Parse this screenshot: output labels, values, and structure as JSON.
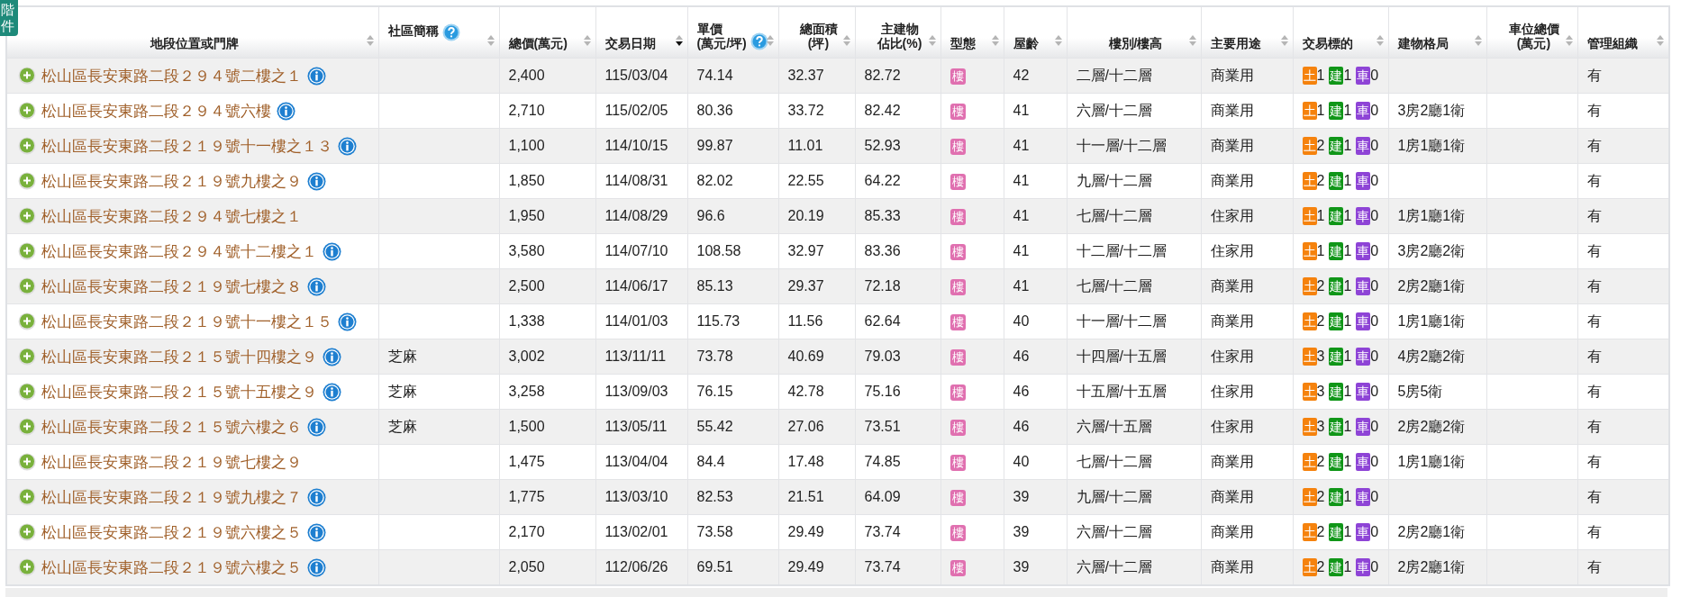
{
  "filter_tab": {
    "lines": [
      "階",
      "件"
    ]
  },
  "table": {
    "columns": [
      {
        "lines": [
          "地段位置或門牌"
        ],
        "help": false,
        "sorted": false
      },
      {
        "lines": [
          "社區簡稱"
        ],
        "help": true,
        "sorted": false
      },
      {
        "lines": [
          "總價(萬元)"
        ],
        "help": false,
        "sorted": false
      },
      {
        "lines": [
          "交易日期"
        ],
        "help": false,
        "sorted": true
      },
      {
        "lines": [
          "單價",
          "(萬元/坪)"
        ],
        "help": true,
        "sorted": false
      },
      {
        "lines": [
          "總面積",
          "(坪)"
        ],
        "help": false,
        "sorted": false
      },
      {
        "lines": [
          "主建物",
          "佔比(%)"
        ],
        "help": false,
        "sorted": false
      },
      {
        "lines": [
          "型態"
        ],
        "help": false,
        "sorted": false
      },
      {
        "lines": [
          "屋齡"
        ],
        "help": false,
        "sorted": false
      },
      {
        "lines": [
          "樓別/樓高"
        ],
        "help": false,
        "sorted": false
      },
      {
        "lines": [
          "主要用途"
        ],
        "help": false,
        "sorted": false
      },
      {
        "lines": [
          "交易標的"
        ],
        "help": false,
        "sorted": false
      },
      {
        "lines": [
          "建物格局"
        ],
        "help": false,
        "sorted": false
      },
      {
        "lines": [
          "車位總價",
          "(萬元)"
        ],
        "help": false,
        "sorted": false
      },
      {
        "lines": [
          "管理組織"
        ],
        "help": false,
        "sorted": false
      }
    ],
    "rows": [
      {
        "address": "松山區長安東路二段２９４號二樓之１",
        "info": true,
        "total": "2,400",
        "date": "115/03/04",
        "unit": "74.14",
        "area": "32.37",
        "ratio": "82.72",
        "type": "樓",
        "age": "42",
        "floor": "二層/十二層",
        "use": "商業用",
        "target": [
          {
            "tag": "土",
            "count": "1",
            "color": "#f5820d"
          },
          {
            "tag": "建",
            "count": "1",
            "color": "#109618"
          },
          {
            "tag": "車",
            "count": "0",
            "color": "#8e44d6"
          }
        ],
        "layout": "",
        "parking": "",
        "management": "有"
      },
      {
        "address": "松山區長安東路二段２９４號六樓",
        "info": true,
        "total": "2,710",
        "date": "115/02/05",
        "unit": "80.36",
        "area": "33.72",
        "ratio": "82.42",
        "type": "樓",
        "age": "41",
        "floor": "六層/十二層",
        "use": "商業用",
        "target": [
          {
            "tag": "土",
            "count": "1",
            "color": "#f5820d"
          },
          {
            "tag": "建",
            "count": "1",
            "color": "#109618"
          },
          {
            "tag": "車",
            "count": "0",
            "color": "#8e44d6"
          }
        ],
        "layout": "3房2廳1衛",
        "parking": "",
        "management": "有"
      },
      {
        "address": "松山區長安東路二段２１９號十一樓之１３",
        "info": true,
        "total": "1,100",
        "date": "114/10/15",
        "unit": "99.87",
        "area": "11.01",
        "ratio": "52.93",
        "type": "樓",
        "age": "41",
        "floor": "十一層/十二層",
        "use": "商業用",
        "target": [
          {
            "tag": "土",
            "count": "2",
            "color": "#f5820d"
          },
          {
            "tag": "建",
            "count": "1",
            "color": "#109618"
          },
          {
            "tag": "車",
            "count": "0",
            "color": "#8e44d6"
          }
        ],
        "layout": "1房1廳1衛",
        "parking": "",
        "management": "有"
      },
      {
        "address": "松山區長安東路二段２１９號九樓之９",
        "info": true,
        "total": "1,850",
        "date": "114/08/31",
        "unit": "82.02",
        "area": "22.55",
        "ratio": "64.22",
        "type": "樓",
        "age": "41",
        "floor": "九層/十二層",
        "use": "商業用",
        "target": [
          {
            "tag": "土",
            "count": "2",
            "color": "#f5820d"
          },
          {
            "tag": "建",
            "count": "1",
            "color": "#109618"
          },
          {
            "tag": "車",
            "count": "0",
            "color": "#8e44d6"
          }
        ],
        "layout": "",
        "parking": "",
        "management": "有"
      },
      {
        "address": "松山區長安東路二段２９４號七樓之１",
        "info": false,
        "total": "1,950",
        "date": "114/08/29",
        "unit": "96.6",
        "area": "20.19",
        "ratio": "85.33",
        "type": "樓",
        "age": "41",
        "floor": "七層/十二層",
        "use": "住家用",
        "target": [
          {
            "tag": "土",
            "count": "1",
            "color": "#f5820d"
          },
          {
            "tag": "建",
            "count": "1",
            "color": "#109618"
          },
          {
            "tag": "車",
            "count": "0",
            "color": "#8e44d6"
          }
        ],
        "layout": "1房1廳1衛",
        "parking": "",
        "management": "有"
      },
      {
        "address": "松山區長安東路二段２９４號十二樓之１",
        "info": true,
        "total": "3,580",
        "date": "114/07/10",
        "unit": "108.58",
        "area": "32.97",
        "ratio": "83.36",
        "type": "樓",
        "age": "41",
        "floor": "十二層/十二層",
        "use": "住家用",
        "target": [
          {
            "tag": "土",
            "count": "1",
            "color": "#f5820d"
          },
          {
            "tag": "建",
            "count": "1",
            "color": "#109618"
          },
          {
            "tag": "車",
            "count": "0",
            "color": "#8e44d6"
          }
        ],
        "layout": "3房2廳2衛",
        "parking": "",
        "management": "有"
      },
      {
        "address": "松山區長安東路二段２１９號七樓之８",
        "info": true,
        "total": "2,500",
        "date": "114/06/17",
        "unit": "85.13",
        "area": "29.37",
        "ratio": "72.18",
        "type": "樓",
        "age": "41",
        "floor": "七層/十二層",
        "use": "商業用",
        "target": [
          {
            "tag": "土",
            "count": "2",
            "color": "#f5820d"
          },
          {
            "tag": "建",
            "count": "1",
            "color": "#109618"
          },
          {
            "tag": "車",
            "count": "0",
            "color": "#8e44d6"
          }
        ],
        "layout": "2房2廳1衛",
        "parking": "",
        "management": "有"
      },
      {
        "address": "松山區長安東路二段２１９號十一樓之１５",
        "info": true,
        "total": "1,338",
        "date": "114/01/03",
        "unit": "115.73",
        "area": "11.56",
        "ratio": "62.64",
        "type": "樓",
        "age": "40",
        "floor": "十一層/十二層",
        "use": "商業用",
        "target": [
          {
            "tag": "土",
            "count": "2",
            "color": "#f5820d"
          },
          {
            "tag": "建",
            "count": "1",
            "color": "#109618"
          },
          {
            "tag": "車",
            "count": "0",
            "color": "#8e44d6"
          }
        ],
        "layout": "1房1廳1衛",
        "parking": "",
        "management": "有"
      },
      {
        "address": "松山區長安東路二段２１５號十四樓之９",
        "info": true,
        "community": "芝麻",
        "total": "3,002",
        "date": "113/11/11",
        "unit": "73.78",
        "area": "40.69",
        "ratio": "79.03",
        "type": "樓",
        "age": "46",
        "floor": "十四層/十五層",
        "use": "住家用",
        "target": [
          {
            "tag": "土",
            "count": "3",
            "color": "#f5820d"
          },
          {
            "tag": "建",
            "count": "1",
            "color": "#109618"
          },
          {
            "tag": "車",
            "count": "0",
            "color": "#8e44d6"
          }
        ],
        "layout": "4房2廳2衛",
        "parking": "",
        "management": "有"
      },
      {
        "address": "松山區長安東路二段２１５號十五樓之９",
        "info": true,
        "community": "芝麻",
        "total": "3,258",
        "date": "113/09/03",
        "unit": "76.15",
        "area": "42.78",
        "ratio": "75.16",
        "type": "樓",
        "age": "46",
        "floor": "十五層/十五層",
        "use": "住家用",
        "target": [
          {
            "tag": "土",
            "count": "3",
            "color": "#f5820d"
          },
          {
            "tag": "建",
            "count": "1",
            "color": "#109618"
          },
          {
            "tag": "車",
            "count": "0",
            "color": "#8e44d6"
          }
        ],
        "layout": "5房5衛",
        "parking": "",
        "management": "有"
      },
      {
        "address": "松山區長安東路二段２１５號六樓之６",
        "info": true,
        "community": "芝麻",
        "total": "1,500",
        "date": "113/05/11",
        "unit": "55.42",
        "area": "27.06",
        "ratio": "73.51",
        "type": "樓",
        "age": "46",
        "floor": "六層/十五層",
        "use": "住家用",
        "target": [
          {
            "tag": "土",
            "count": "3",
            "color": "#f5820d"
          },
          {
            "tag": "建",
            "count": "1",
            "color": "#109618"
          },
          {
            "tag": "車",
            "count": "0",
            "color": "#8e44d6"
          }
        ],
        "layout": "2房2廳2衛",
        "parking": "",
        "management": "有"
      },
      {
        "address": "松山區長安東路二段２１９號七樓之９",
        "info": false,
        "total": "1,475",
        "date": "113/04/04",
        "unit": "84.4",
        "area": "17.48",
        "ratio": "74.85",
        "type": "樓",
        "age": "40",
        "floor": "七層/十二層",
        "use": "商業用",
        "target": [
          {
            "tag": "土",
            "count": "2",
            "color": "#f5820d"
          },
          {
            "tag": "建",
            "count": "1",
            "color": "#109618"
          },
          {
            "tag": "車",
            "count": "0",
            "color": "#8e44d6"
          }
        ],
        "layout": "1房1廳1衛",
        "parking": "",
        "management": "有"
      },
      {
        "address": "松山區長安東路二段２１９號九樓之７",
        "info": true,
        "total": "1,775",
        "date": "113/03/10",
        "unit": "82.53",
        "area": "21.51",
        "ratio": "64.09",
        "type": "樓",
        "age": "39",
        "floor": "九層/十二層",
        "use": "商業用",
        "target": [
          {
            "tag": "土",
            "count": "2",
            "color": "#f5820d"
          },
          {
            "tag": "建",
            "count": "1",
            "color": "#109618"
          },
          {
            "tag": "車",
            "count": "0",
            "color": "#8e44d6"
          }
        ],
        "layout": "",
        "parking": "",
        "management": "有"
      },
      {
        "address": "松山區長安東路二段２１９號六樓之５",
        "info": true,
        "total": "2,170",
        "date": "113/02/01",
        "unit": "73.58",
        "area": "29.49",
        "ratio": "73.74",
        "type": "樓",
        "age": "39",
        "floor": "六層/十二層",
        "use": "商業用",
        "target": [
          {
            "tag": "土",
            "count": "2",
            "color": "#f5820d"
          },
          {
            "tag": "建",
            "count": "1",
            "color": "#109618"
          },
          {
            "tag": "車",
            "count": "0",
            "color": "#8e44d6"
          }
        ],
        "layout": "2房2廳1衛",
        "parking": "",
        "management": "有"
      },
      {
        "address": "松山區長安東路二段２１９號六樓之５",
        "info": true,
        "total": "2,050",
        "date": "112/06/26",
        "unit": "69.51",
        "area": "29.49",
        "ratio": "73.74",
        "type": "樓",
        "age": "39",
        "floor": "六層/十二層",
        "use": "商業用",
        "target": [
          {
            "tag": "土",
            "count": "2",
            "color": "#f5820d"
          },
          {
            "tag": "建",
            "count": "1",
            "color": "#109618"
          },
          {
            "tag": "車",
            "count": "0",
            "color": "#8e44d6"
          }
        ],
        "layout": "2房2廳1衛",
        "parking": "",
        "management": "有"
      }
    ]
  }
}
